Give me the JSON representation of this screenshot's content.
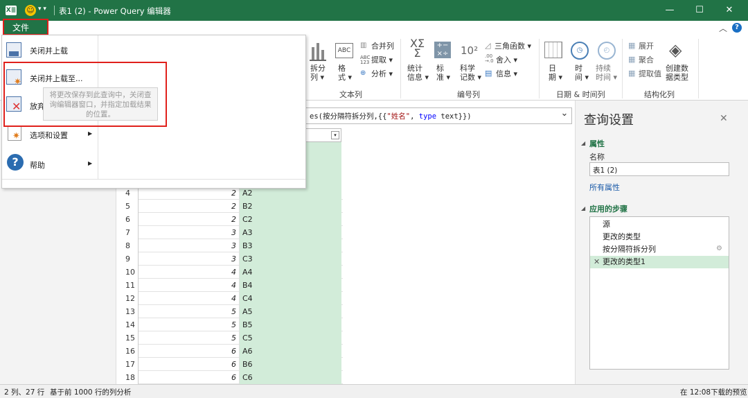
{
  "window": {
    "title": "表1 (2) - Power Query 编辑器",
    "minimize": "—",
    "maximize": "☐",
    "close": "✕"
  },
  "file_tab": "文件",
  "ribbon": {
    "split_col": "拆分\n列 ▾",
    "format": "格\n式 ▾",
    "merge_cols": "合并列",
    "extract": "提取 ▾",
    "parse": "分析 ▾",
    "statistics": "统计\n信息 ▾",
    "standard": "标\n准 ▾",
    "scientific": "科学\n记数 ▾",
    "trig": "三角函数 ▾",
    "round": "舍入 ▾",
    "info": "信息 ▾",
    "date": "日\n期 ▾",
    "time": "时\n间 ▾",
    "duration": "持续\n时间 ▾",
    "expand": "展开",
    "aggregate": "聚合",
    "extract_values": "提取值",
    "create_datatype": "创建数\n据类型",
    "group_text": "文本列",
    "group_number": "编号列",
    "group_datetime": "日期 & 时间列",
    "group_structured": "结构化列"
  },
  "file_menu": {
    "items": [
      "关闭并上载",
      "关闭并上载至...",
      "放弃并关闭",
      "选项和设置",
      "帮助"
    ],
    "tooltip": "将更改保存到此查询中，关闭查询编辑器窗口，并指定加载结果的位置。"
  },
  "formula": {
    "prefix": "es(按分隔符拆分列,{{",
    "string": "\"姓名\"",
    "mid": ", ",
    "keyword": "type",
    "suffix": " text}})",
    "dropdown": "⌄"
  },
  "table": {
    "rows": [
      {
        "n": "4",
        "v": "2",
        "t": "A2"
      },
      {
        "n": "5",
        "v": "2",
        "t": "B2"
      },
      {
        "n": "6",
        "v": "2",
        "t": "C2"
      },
      {
        "n": "7",
        "v": "3",
        "t": "A3"
      },
      {
        "n": "8",
        "v": "3",
        "t": "B3"
      },
      {
        "n": "9",
        "v": "3",
        "t": "C3"
      },
      {
        "n": "10",
        "v": "4",
        "t": "A4"
      },
      {
        "n": "11",
        "v": "4",
        "t": "B4"
      },
      {
        "n": "12",
        "v": "4",
        "t": "C4"
      },
      {
        "n": "13",
        "v": "5",
        "t": "A5"
      },
      {
        "n": "14",
        "v": "5",
        "t": "B5"
      },
      {
        "n": "15",
        "v": "5",
        "t": "C5"
      },
      {
        "n": "16",
        "v": "6",
        "t": "A6"
      },
      {
        "n": "17",
        "v": "6",
        "t": "B6"
      },
      {
        "n": "18",
        "v": "6",
        "t": "C6"
      }
    ]
  },
  "query_settings": {
    "title": "查询设置",
    "close": "✕",
    "properties_header": "属性",
    "name_label": "名称",
    "name_value": "表1 (2)",
    "all_properties": "所有属性",
    "steps_header": "应用的步骤",
    "steps": [
      "源",
      "更改的类型",
      "按分隔符拆分列",
      "更改的类型1"
    ]
  },
  "status": {
    "left": "2 列、27 行",
    "mid": "基于前 1000 行的列分析",
    "right": "在 12:08下载的预览"
  },
  "colors": {
    "accent": "#217346",
    "highlight": "#e0201b",
    "column_fill": "#d2ecd9",
    "step_selected": "#d2ecd9"
  }
}
